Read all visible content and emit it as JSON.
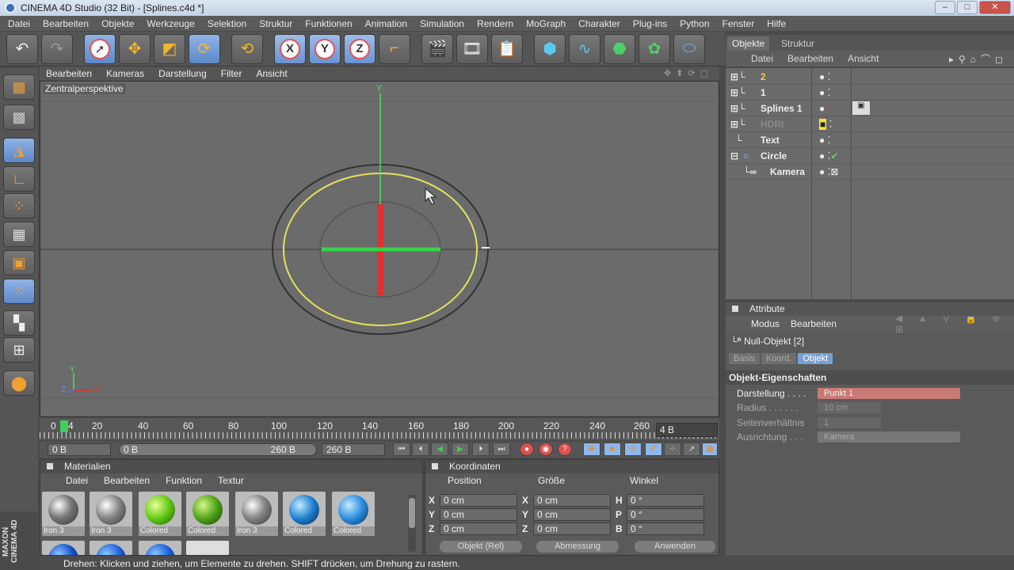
{
  "window": {
    "title": "CINEMA 4D Studio (32 Bit) - [Splines.c4d *]"
  },
  "menubar": [
    "Datei",
    "Bearbeiten",
    "Objekte",
    "Werkzeuge",
    "Selektion",
    "Struktur",
    "Funktionen",
    "Animation",
    "Simulation",
    "Rendern",
    "MoGraph",
    "Charakter",
    "Plug-ins",
    "Python",
    "Fenster",
    "Hilfe"
  ],
  "viewport": {
    "menu": [
      "Bearbeiten",
      "Kameras",
      "Darstellung",
      "Filter",
      "Ansicht"
    ],
    "label": "Zentralperspektive",
    "axis_y": "Y",
    "axis_z": "Z",
    "axis_x": "X"
  },
  "timeline": {
    "ticks": [
      "0",
      "20",
      "40",
      "60",
      "80",
      "100",
      "120",
      "140",
      "160",
      "180",
      "200",
      "220",
      "240",
      "260"
    ],
    "frame_display": "4 B",
    "current": "4"
  },
  "playbar": {
    "start": "0 B",
    "range_start": "0 B",
    "range_end": "260 B",
    "end": "260 B"
  },
  "materials": {
    "title": "Materialien",
    "menu": [
      "Datei",
      "Bearbeiten",
      "Funktion",
      "Textur"
    ],
    "items": [
      "Iron 3",
      "Iron 3",
      "Colored",
      "Colored",
      "Iron 3",
      "Colored",
      "Colored"
    ]
  },
  "coordinates": {
    "title": "Koordinaten",
    "headers": [
      "Position",
      "Größe",
      "Winkel"
    ],
    "rows": [
      {
        "axis": "X",
        "pos": "0 cm",
        "size_axis": "X",
        "size": "0 cm",
        "ang_axis": "H",
        "angle": "0 °"
      },
      {
        "axis": "Y",
        "pos": "0 cm",
        "size_axis": "Y",
        "size": "0 cm",
        "ang_axis": "P",
        "angle": "0 °"
      },
      {
        "axis": "Z",
        "pos": "0 cm",
        "size_axis": "Z",
        "size": "0 cm",
        "ang_axis": "B",
        "angle": "0 °"
      }
    ],
    "mode": "Objekt (Rel)",
    "measure": "Abmessung",
    "apply": "Anwenden"
  },
  "status": "Drehen: Klicken und ziehen, um Elemente zu drehen. SHIFT drücken, um Drehung zu rastern.",
  "object_manager": {
    "tabs": [
      "Objekte",
      "Struktur"
    ],
    "menu": [
      "Datei",
      "Bearbeiten",
      "Ansicht"
    ],
    "objects": [
      {
        "name": "2",
        "color": "#f5c542"
      },
      {
        "name": "1",
        "color": "#eeeeee"
      },
      {
        "name": "Splines 1",
        "color": "#eeeeee"
      },
      {
        "name": "HDRI",
        "color": "#8a8a8a"
      },
      {
        "name": "Text",
        "color": "#eeeeee"
      },
      {
        "name": "Circle",
        "color": "#eeeeee"
      },
      {
        "name": "Kamera",
        "color": "#eeeeee"
      }
    ]
  },
  "attributes": {
    "title": "Attribute",
    "menu": [
      "Modus",
      "Bearbeiten"
    ],
    "object": "Null-Objekt [2]",
    "tabs": [
      "Basis",
      "Koord.",
      "Objekt"
    ],
    "section": "Objekt-Eigenschaften",
    "props": [
      {
        "label": "Darstellung . . . .",
        "value": "Punkt 1"
      },
      {
        "label": "Radius . . . . . .",
        "value": "10 cm"
      },
      {
        "label": "Seitenverhältnis",
        "value": "1"
      },
      {
        "label": "Ausrichtung . . .",
        "value": "Kamera"
      }
    ]
  },
  "branding": "MAXON CINEMA 4D"
}
